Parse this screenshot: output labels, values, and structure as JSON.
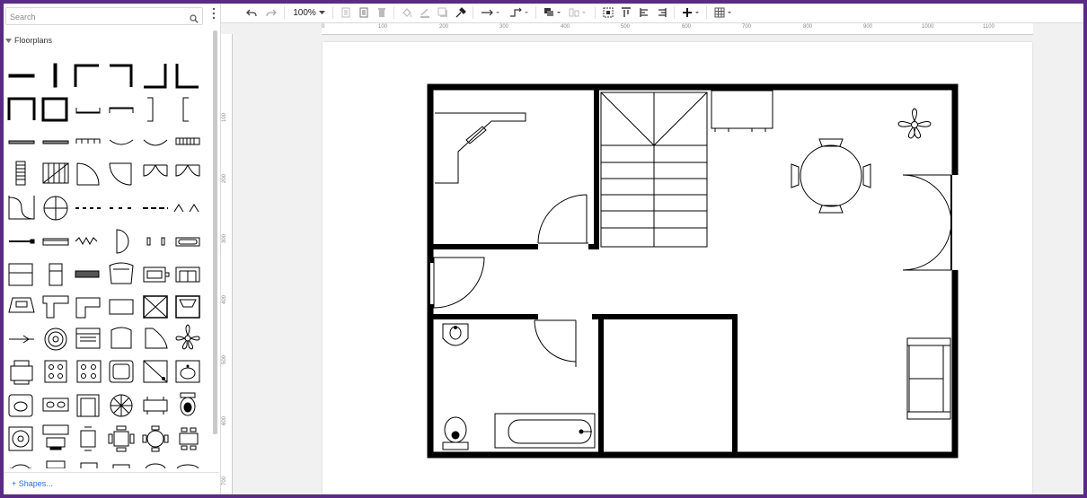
{
  "sidebar": {
    "search_placeholder": "Search",
    "category": "Floorplans",
    "more_shapes": "+ Shapes..."
  },
  "toolbar": {
    "zoom": "100%",
    "icons": [
      "undo-icon",
      "redo-icon",
      "zoom-dropdown",
      "to-front-icon",
      "to-back-icon",
      "delete-icon",
      "fill-color-icon",
      "line-color-icon",
      "shadow-icon",
      "format-painter-icon",
      "connection-icon",
      "waypoints-icon",
      "arrange-icon",
      "align-icon",
      "insert-icon",
      "table-icon"
    ]
  },
  "ruler": {
    "h_ticks": [
      "0",
      "100",
      "200",
      "300",
      "400",
      "500",
      "600",
      "700",
      "800",
      "900",
      "1000",
      "1100"
    ],
    "v_ticks": [
      "100",
      "200",
      "300",
      "400",
      "500",
      "600",
      "700"
    ]
  },
  "colors": {
    "frame": "#5b2a86",
    "link": "#1a73e8",
    "wall": "#000000",
    "canvas_bg": "#f1f1f1"
  }
}
